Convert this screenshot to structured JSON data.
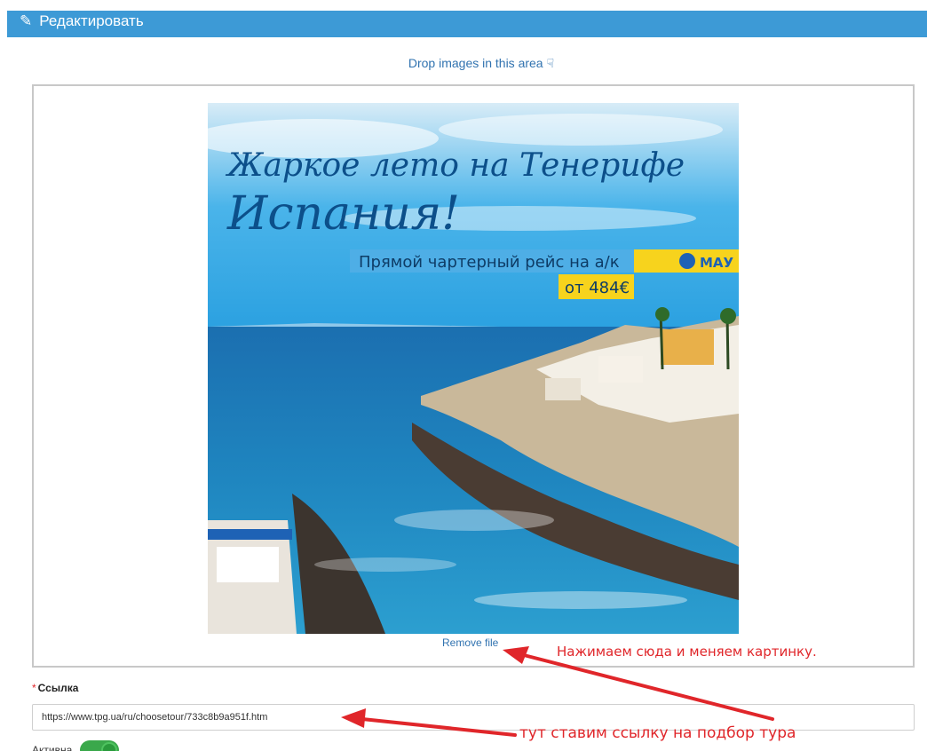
{
  "header": {
    "title": "Редактировать",
    "icon": "pencil-icon"
  },
  "dropzone": {
    "hint": "Drop images in this area",
    "hint_icon": "hand-pointer-icon"
  },
  "preview": {
    "line1": "Жаркое лето на Тенерифе",
    "line2": "Испания!",
    "banner": "Прямой чартерный рейс на а/к",
    "airline": "МАУ",
    "price": "от 484€"
  },
  "remove_file": "Remove file",
  "annotations": {
    "remove_note": "Нажимаем сюда и меняем картинку.",
    "link_note": "тут ставим ссылку на подбор тура",
    "color": "#e0262a"
  },
  "link_field": {
    "required_mark": "*",
    "label": "Ссылка",
    "value": "https://www.tpg.ua/ru/choosetour/733c8b9a951f.htm"
  },
  "active_field": {
    "label": "Активна",
    "enabled": true
  },
  "colors": {
    "header": "#3d9ad6",
    "link": "#3173b0",
    "toggle": "#3aa84b"
  }
}
